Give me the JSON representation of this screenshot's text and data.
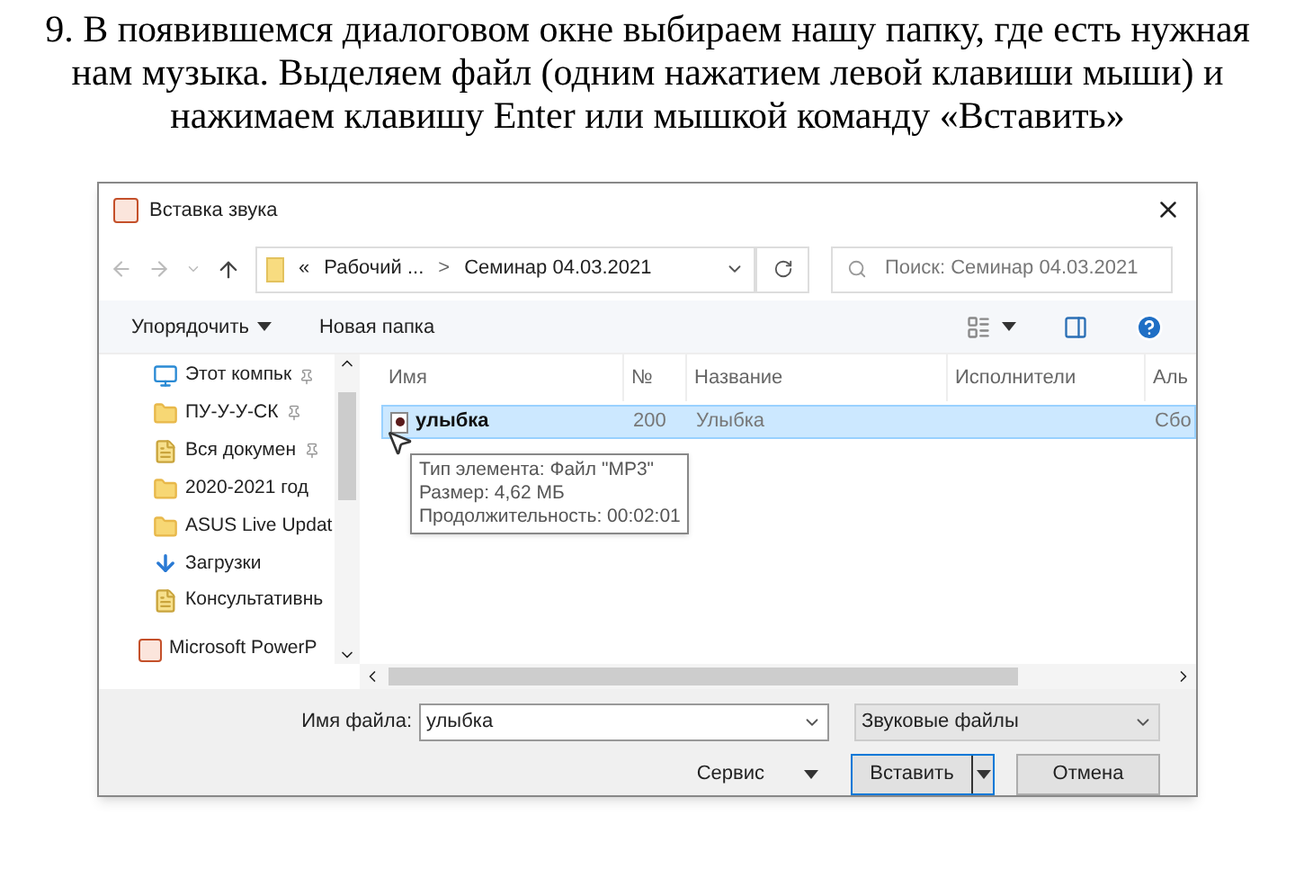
{
  "instruction": "9. В появившемся диалоговом окне выбираем нашу папку, где есть нужная нам музыка. Выделяем файл (одним нажатием левой клавиши мыши) и нажимаем клавишу Enter или мышкой команду «Вставить»",
  "dialog": {
    "title": "Вставка звука",
    "address": {
      "overflow": "«",
      "crumbs": [
        "Рабочий ...",
        "Семинар 04.03.2021"
      ],
      "separator": ">"
    },
    "search": {
      "placeholder": "Поиск: Семинар 04.03.2021"
    },
    "toolbar": [
      "Упорядочить",
      "Новая папка"
    ],
    "nav_items": [
      {
        "label": "Этот компьк",
        "kind": "computer",
        "pinned": true
      },
      {
        "label": "ПУ-У-У-СК",
        "kind": "folder",
        "pinned": true
      },
      {
        "label": "Вся докумен",
        "kind": "shortcut",
        "pinned": true
      },
      {
        "label": "2020-2021 год",
        "kind": "folder",
        "pinned": false
      },
      {
        "label": "ASUS Live Updat",
        "kind": "folder",
        "pinned": false
      },
      {
        "label": "Загрузки",
        "kind": "downloads",
        "pinned": false
      },
      {
        "label": "Консультативнь",
        "kind": "shortcut",
        "pinned": false
      },
      {
        "label": "Microsoft PowerP",
        "kind": "app",
        "pinned": false
      }
    ],
    "columns": [
      "Имя",
      "№",
      "Название",
      "Исполнители",
      "Аль"
    ],
    "rows": [
      {
        "cells": [
          "улыбка",
          "200",
          "Улыбка",
          "",
          "Сбо"
        ],
        "selected": true
      }
    ],
    "tooltip": [
      "Тип элемента: Файл \"MP3\"",
      "Размер: 4,62 МБ",
      "Продолжительность: 00:02:01"
    ],
    "file_name_label": "Имя файла:",
    "file_name": "улыбка",
    "file_type": "Звуковые файлы",
    "tools": "Сервис",
    "buttons": [
      {
        "label": "Вставить",
        "kind": "split"
      },
      {
        "label": "Отмена",
        "kind": "plain"
      }
    ]
  }
}
